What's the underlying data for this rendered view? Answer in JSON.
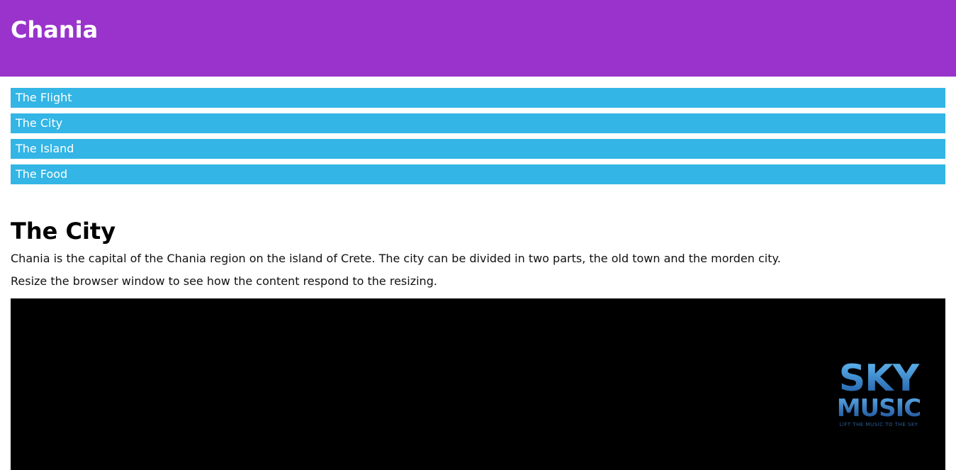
{
  "header": {
    "title": "Chania"
  },
  "menu": {
    "items": [
      {
        "label": "The Flight"
      },
      {
        "label": "The City"
      },
      {
        "label": "The Island"
      },
      {
        "label": "The Food"
      }
    ]
  },
  "main": {
    "heading": "The City",
    "paragraphs": [
      "Chania is the capital of the Chania region on the island of Crete. The city can be divided in two parts, the old town and the morden city.",
      "Resize the browser window to see how the content respond to the resizing."
    ]
  },
  "video": {
    "logo_line1": "SKY",
    "logo_line2": "MUSIC",
    "logo_tagline": "LIFT THE MUSIC TO THE SKY"
  },
  "colors": {
    "header_bg": "#9933cc",
    "menu_bg": "#33b5e5",
    "video_bg": "#000000"
  }
}
